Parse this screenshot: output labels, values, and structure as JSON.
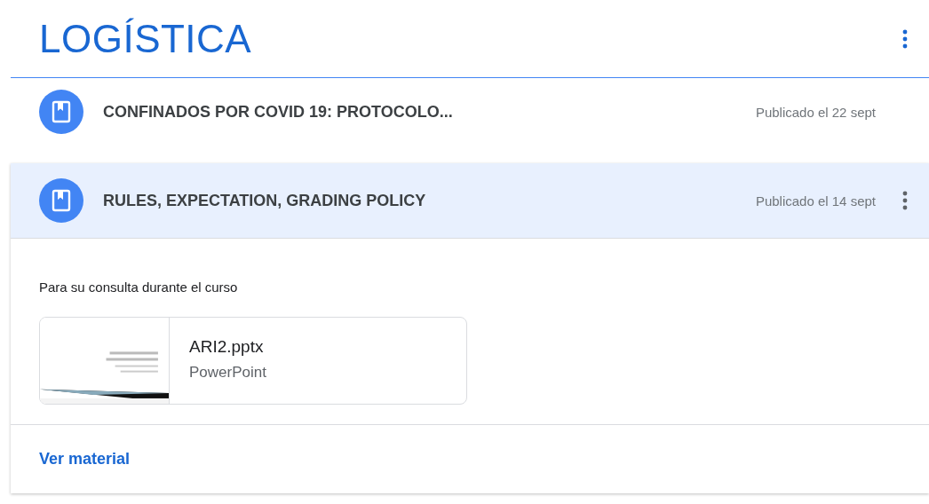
{
  "topic": {
    "title": "LOGÍSTICA"
  },
  "materials": [
    {
      "title": "CONFINADOS POR COVID 19: PROTOCOLO...",
      "posted": "Publicado el 22 sept",
      "expanded": false
    },
    {
      "title": "RULES, EXPECTATION, GRADING POLICY",
      "posted": "Publicado el 14 sept",
      "expanded": true,
      "description": "Para su consulta durante el curso",
      "attachment": {
        "name": "ARI2.pptx",
        "type": "PowerPoint"
      },
      "link": "Ver material"
    }
  ]
}
